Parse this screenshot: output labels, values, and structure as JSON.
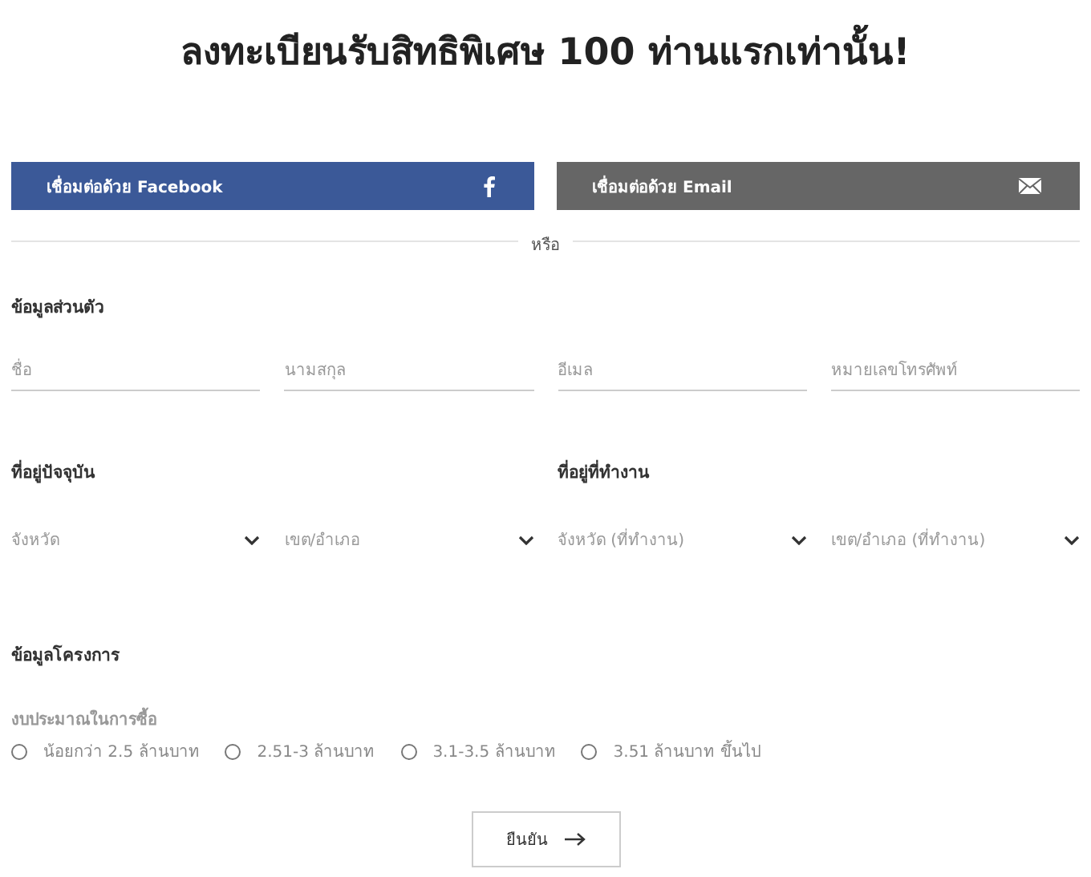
{
  "title": "ลงทะเบียนรับสิทธิพิเศษ 100 ท่านแรกเท่านั้น!",
  "social_buttons": [
    {
      "label": "เชื่อมต่อด้วย Facebook",
      "kind": "facebook"
    },
    {
      "label": "เชื่อมต่อด้วย Email",
      "kind": "email"
    }
  ],
  "divider_text": "หรือ",
  "personal": {
    "heading": "ข้อมูลส่วนตัว",
    "fields": [
      {
        "placeholder": "ชื่อ"
      },
      {
        "placeholder": "นามสกุล"
      },
      {
        "placeholder": "อีเมล"
      },
      {
        "placeholder": "หมายเลขโทรศัพท์"
      }
    ]
  },
  "addresses": [
    {
      "heading": "ที่อยู่ปัจจุบัน",
      "selects": [
        {
          "placeholder": "จังหวัด"
        },
        {
          "placeholder": "เขต/อำเภอ"
        }
      ]
    },
    {
      "heading": "ที่อยู่ที่ทำงาน",
      "selects": [
        {
          "placeholder": "จังหวัด (ที่ทำงาน)"
        },
        {
          "placeholder": "เขต/อำเภอ (ที่ทำงาน)"
        }
      ]
    }
  ],
  "project": {
    "heading": "ข้อมูลโครงการ",
    "budget_label": "งบประมาณในการซื้อ",
    "options": [
      {
        "label": "น้อยกว่า 2.5 ล้านบาท",
        "selected": false
      },
      {
        "label": "2.51-3 ล้านบาท",
        "selected": false
      },
      {
        "label": "3.1-3.5 ล้านบาท",
        "selected": false
      },
      {
        "label": "3.51 ล้านบาท ขึ้นไป",
        "selected": false
      }
    ]
  },
  "submit": {
    "label": "ยืนยัน"
  }
}
